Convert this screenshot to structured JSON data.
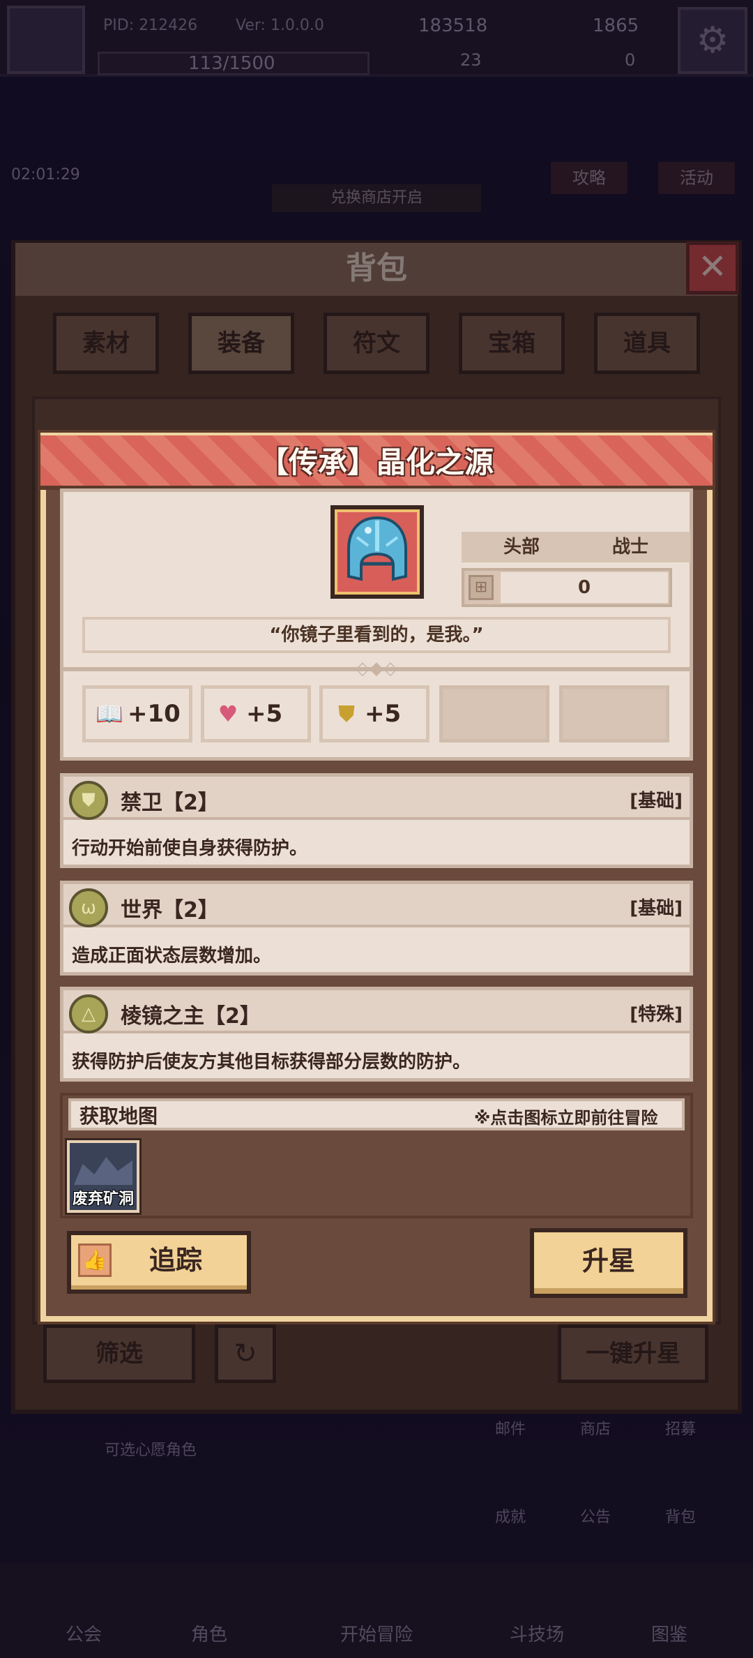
{
  "hud": {
    "pid": "PID: 212426",
    "version": "Ver: 1.0.0.0",
    "energy": "113/1500",
    "gold": "183518",
    "gems": "1865",
    "token_a": "23",
    "token_b": "0",
    "timer": "02:01:29",
    "shop_banner": "兑换商店开启",
    "guide_label": "攻略",
    "event_label": "活动"
  },
  "side_menu": {
    "mail": "邮件",
    "shop": "商店",
    "recruit": "招募",
    "achievement": "成就",
    "notice": "公告",
    "bag": "背包",
    "wish_hint": "可选心愿角色"
  },
  "bottom_nav": [
    "公会",
    "角色",
    "开始冒险",
    "斗技场",
    "图鉴"
  ],
  "bag": {
    "title": "背包",
    "close_icon": "close-icon",
    "tabs": [
      {
        "label": "素材",
        "active": false
      },
      {
        "label": "装备",
        "active": true
      },
      {
        "label": "符文",
        "active": false
      },
      {
        "label": "宝箱",
        "active": false
      },
      {
        "label": "道具",
        "active": false
      }
    ],
    "filter_label": "筛选",
    "one_click_label": "一键升星"
  },
  "item": {
    "title": "【传承】晶化之源",
    "icon": "crystal-helmet-icon",
    "slot": "头部",
    "class": "战士",
    "star_level": "0",
    "quote": "“你镜子里看到的，是我。”",
    "stats": [
      {
        "icon": "book-icon",
        "glyph": "📖",
        "value": "+10"
      },
      {
        "icon": "heart-icon",
        "glyph": "♥",
        "value": "+5"
      },
      {
        "icon": "shield-icon",
        "glyph": "⛊",
        "value": "+5"
      }
    ],
    "skills": [
      {
        "name": "禁卫【2】",
        "type": "[基础]",
        "desc": "行动开始前使自身获得防护。",
        "icon": "guard-shield-icon",
        "glyph": "⛊"
      },
      {
        "name": "世界【2】",
        "type": "[基础]",
        "desc": "造成正面状态层数增加。",
        "icon": "world-icon",
        "glyph": "ω"
      },
      {
        "name": "棱镜之主【2】",
        "type": "[特殊]",
        "desc": "获得防护后使友方其他目标获得部分层数的防护。",
        "icon": "prism-icon",
        "glyph": "△"
      }
    ],
    "map_section": {
      "title": "获取地图",
      "hint": "※点击图标立即前往冒险",
      "maps": [
        {
          "name": "废弃矿洞"
        }
      ]
    },
    "track_label": "追踪",
    "upgrade_label": "升星"
  },
  "colors": {
    "header_red": "#d8645a",
    "panel_cream": "#ece0d6",
    "button_gold": "#f2d296",
    "frame_brown": "#3a2620"
  }
}
